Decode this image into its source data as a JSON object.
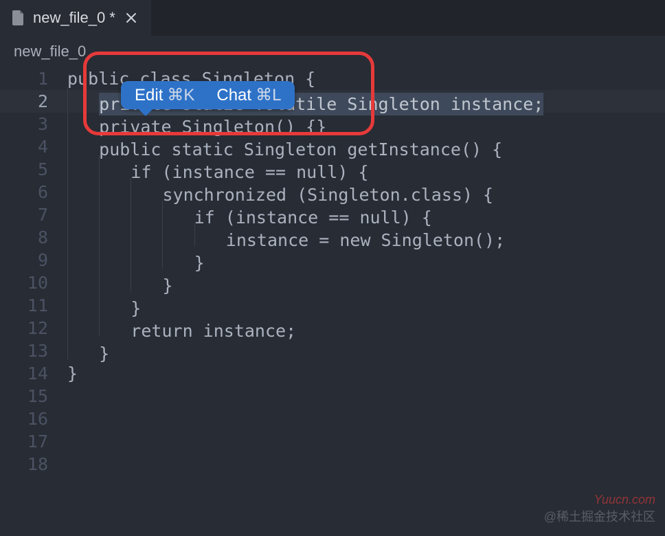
{
  "tab": {
    "title": "new_file_0 *"
  },
  "breadcrumb": {
    "path": "new_file_0"
  },
  "inline_actions": {
    "edit_label": "Edit",
    "edit_shortcut": "⌘K",
    "chat_label": "Chat",
    "chat_shortcut": "⌘L"
  },
  "selected_line_index": 1,
  "code_lines": [
    "public class Singleton {",
    "    private static volatile Singleton instance;",
    "    private Singleton() {}",
    "    public static Singleton getInstance() {",
    "        if (instance == null) {",
    "            synchronized (Singleton.class) {",
    "                if (instance == null) {",
    "                    instance = new Singleton();",
    "                }",
    "            }",
    "        }",
    "        return instance;",
    "    }",
    "}",
    "",
    "",
    "",
    ""
  ],
  "selection": {
    "line": 1,
    "text": "private static volatile Singleton instance;"
  },
  "watermark": {
    "line1": "Yuucn.com",
    "line2": "@稀土掘金技术社区"
  },
  "colors": {
    "accent": "#2e72c8",
    "annotation": "#e63a3a",
    "bg": "#282c34"
  }
}
